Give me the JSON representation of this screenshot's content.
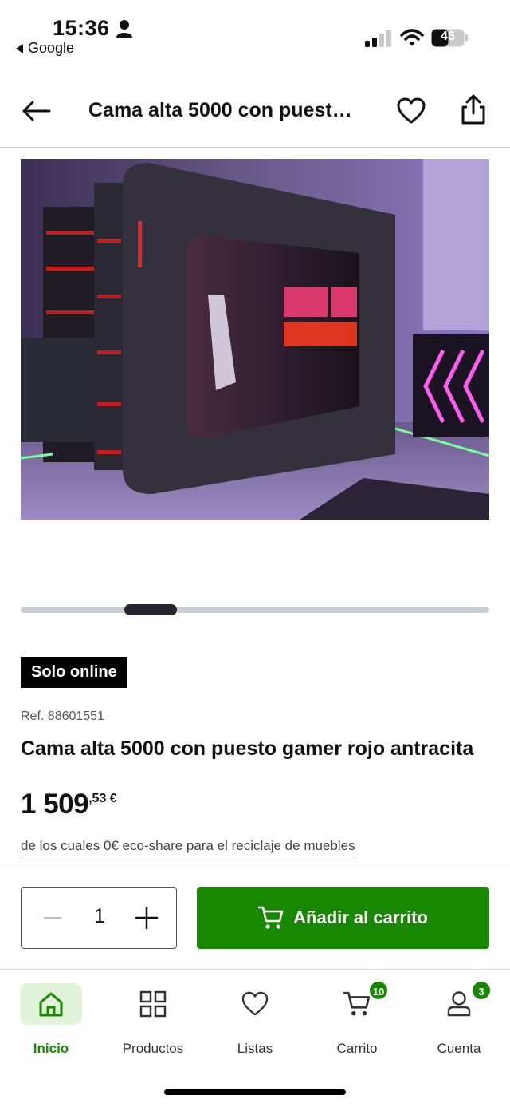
{
  "status": {
    "time": "15:36",
    "back_app": "Google",
    "battery": "46"
  },
  "header": {
    "title": "Cama alta 5000 con puesto gamer rojo antracita"
  },
  "carousel": {
    "position": 0.25
  },
  "product": {
    "badge": "Solo online",
    "ref": "Ref. 88601551",
    "title": "Cama alta 5000 con puesto gamer rojo antracita",
    "price_int": "1 509",
    "price_dec": ",53 €",
    "eco_note": "de los cuales 0€ eco-share para el reciclaje de muebles"
  },
  "actions": {
    "quantity": "1",
    "add_to_cart": "Añadir al carrito"
  },
  "nav": {
    "items": [
      {
        "label": "Inicio",
        "icon": "home-icon",
        "active": true
      },
      {
        "label": "Productos",
        "icon": "grid-icon"
      },
      {
        "label": "Listas",
        "icon": "heart-icon"
      },
      {
        "label": "Carrito",
        "icon": "cart-icon",
        "badge": "10"
      },
      {
        "label": "Cuenta",
        "icon": "user-icon",
        "badge": "3"
      }
    ]
  },
  "colors": {
    "brand_green": "#188803",
    "active_nav_bg": "#e1f3d9"
  }
}
